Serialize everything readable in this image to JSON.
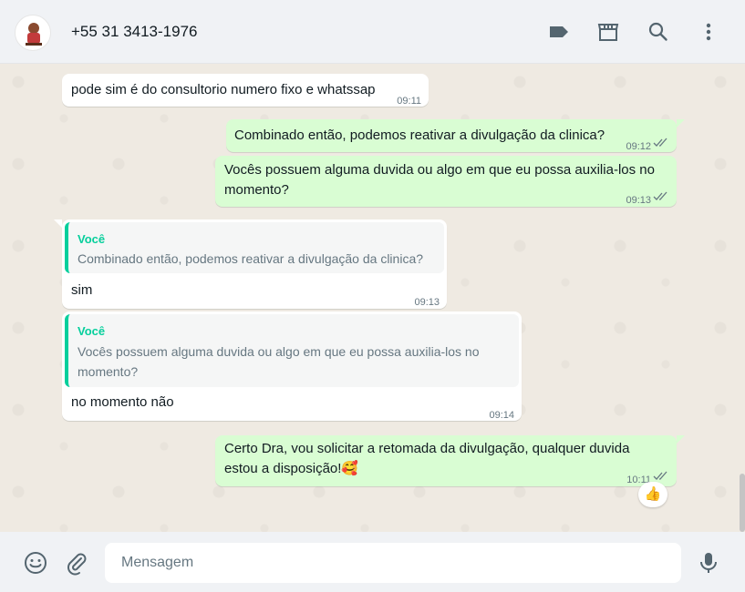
{
  "header": {
    "contact_name": "+55 31 3413-1976",
    "icons": [
      "label-icon",
      "catalog-icon",
      "search-icon",
      "menu-icon"
    ]
  },
  "messages": [
    {
      "direction": "in",
      "text": "pode sim é do consultorio numero fixo e whatssap",
      "time": "09:11"
    },
    {
      "direction": "out",
      "text": "Combinado então, podemos reativar a divulgação da clinica?",
      "time": "09:12",
      "status": "read"
    },
    {
      "direction": "out",
      "text_line1": "Vocês possuem alguma duvida ou algo em que eu possa auxilia-los no",
      "text_line2": "momento?",
      "time": "09:13",
      "status": "read"
    },
    {
      "direction": "in",
      "quote_author": "Você",
      "quote_text": "Combinado então, podemos reativar a divulgação da clinica?",
      "text": "sim",
      "time": "09:13"
    },
    {
      "direction": "in",
      "quote_author": "Você",
      "quote_line1": "Vocês possuem alguma duvida ou algo em que eu possa auxilia-los no",
      "quote_line2": "momento?",
      "text": "no momento não",
      "time": "09:14"
    },
    {
      "direction": "out",
      "text_line1": "Certo Dra, vou solicitar a retomada da divulgação, qualquer duvida",
      "text_line2": "estou a disposição!",
      "emoji": "🥰",
      "time": "10:11",
      "status": "read",
      "reaction": "👍"
    }
  ],
  "footer": {
    "input_placeholder": "Mensagem",
    "icons": [
      "emoji-icon",
      "attach-icon",
      "microphone-icon"
    ]
  },
  "colors": {
    "outgoing_bubble": "#d9fdd3",
    "incoming_bubble": "#ffffff",
    "quote_accent": "#06cf9c",
    "read_ticks": "#667781",
    "chat_background": "#efeae2"
  }
}
